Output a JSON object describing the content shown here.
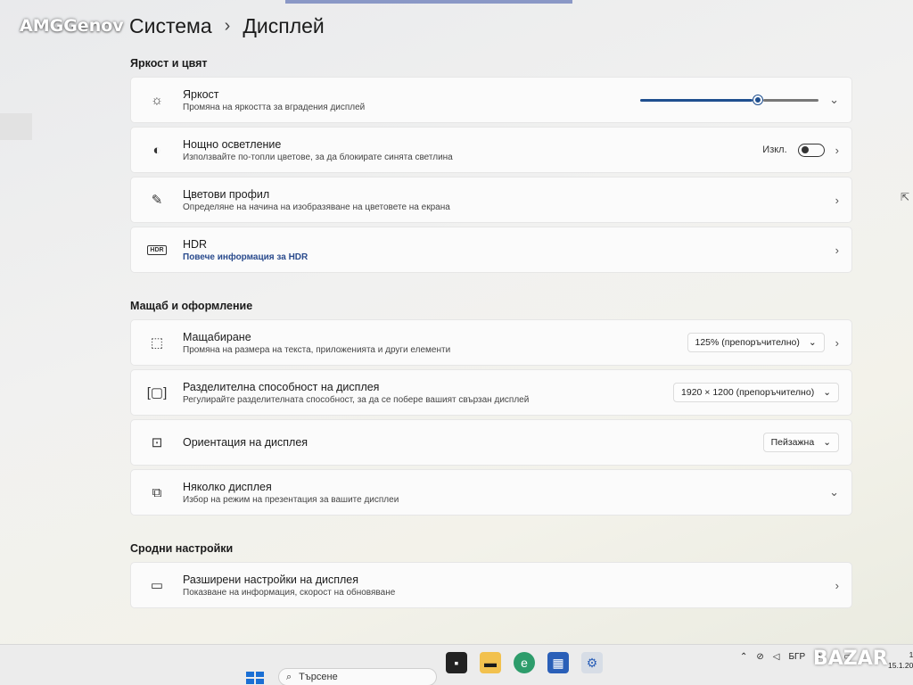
{
  "watermark": "AMGGenov",
  "breadcrumb": {
    "parent": "Система",
    "separator": "›",
    "current": "Дисплей"
  },
  "sections": {
    "brightness_color": {
      "title": "Яркост и цвят",
      "brightness": {
        "label": "Яркост",
        "description": "Промяна на яркостта за вградения дисплей",
        "icon": "sun-icon",
        "level_fraction": 0.66
      },
      "night_light": {
        "label": "Нощно осветление",
        "description": "Използвайте по-топли цветове, за да блокирате синята светлина",
        "icon": "night-light-icon",
        "state": "Изкл."
      },
      "color_profile": {
        "label": "Цветови профил",
        "description": "Определяне на начина на изобразяване на цветовете на екрана",
        "icon": "eyedropper-icon"
      },
      "hdr": {
        "label": "HDR",
        "link": "Повече информация за HDR",
        "icon": "hdr-icon"
      }
    },
    "scale_layout": {
      "title": "Мащаб и оформление",
      "scale": {
        "label": "Мащабиране",
        "description": "Промяна на размера на текста, приложенията и други елементи",
        "value": "125% (препоръчително)",
        "icon": "scale-icon"
      },
      "resolution": {
        "label": "Разделителна способност на дисплея",
        "description": "Регулирайте разделителната способност, за да се побере вашият свързан дисплей",
        "value": "1920 × 1200 (препоръчително)",
        "icon": "resolution-icon"
      },
      "orientation": {
        "label": "Ориентация на дисплея",
        "value": "Пейзажна",
        "icon": "orientation-icon"
      },
      "multiple": {
        "label": "Няколко дисплея",
        "description": "Избор на режим на презентация за вашите дисплеи",
        "icon": "multiple-displays-icon"
      }
    },
    "related": {
      "title": "Сродни настройки",
      "advanced": {
        "label": "Разширени настройки на дисплея",
        "description": "Показване на информация, скорост на обновяване",
        "icon": "monitor-icon"
      }
    }
  },
  "taskbar": {
    "search_placeholder": "Търсене",
    "tray_language": "БГР",
    "clock_date": "15.1.20",
    "clock_time": "1"
  },
  "bazar_logo": "BAZAR",
  "colors": {
    "accent": "#1f4f8f",
    "start": "#1b6fd4"
  }
}
